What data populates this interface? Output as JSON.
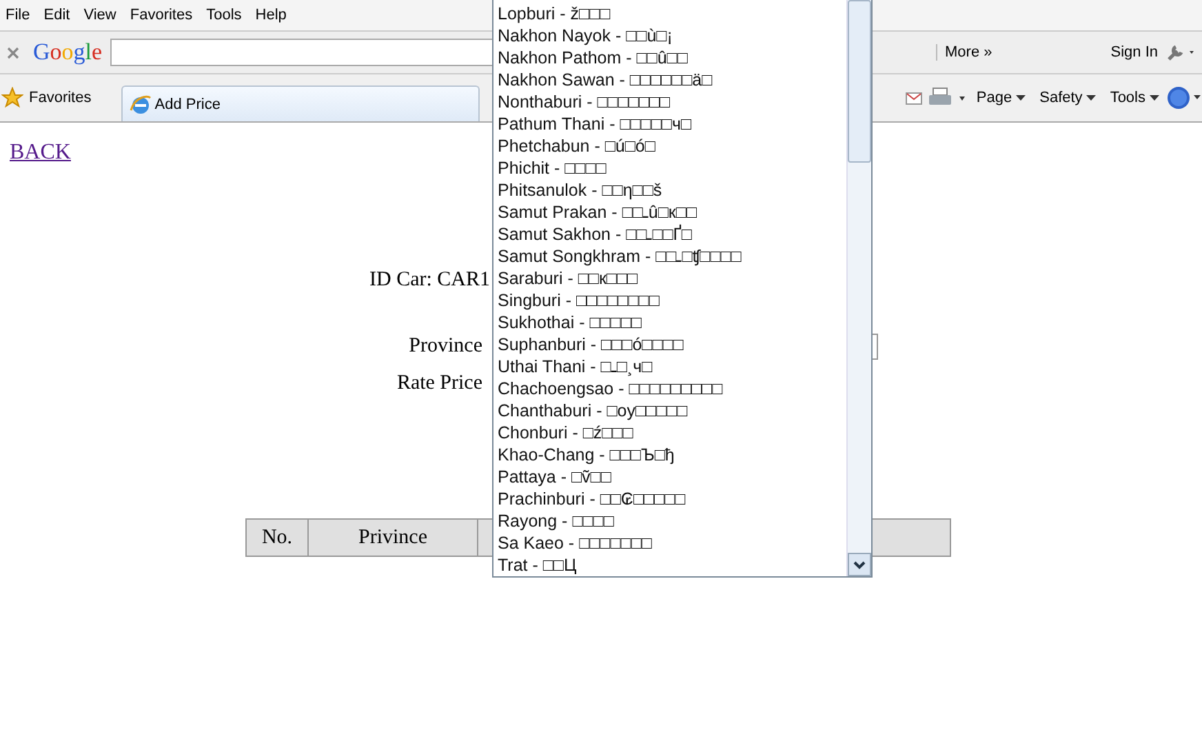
{
  "menu_bar": [
    "File",
    "Edit",
    "View",
    "Favorites",
    "Tools",
    "Help"
  ],
  "google_toolbar": {
    "logo": "Google",
    "more": "More »",
    "sign_in": "Sign In"
  },
  "favorites_bar": {
    "favorites": "Favorites",
    "tab": "Add Price",
    "commands": [
      "Page",
      "Safety",
      "Tools"
    ]
  },
  "page": {
    "back_link": "BACK",
    "id_car": "ID Car: CAR1",
    "fields": [
      {
        "label": "Province",
        "kind": "select"
      },
      {
        "label": "Rate Price",
        "kind": "text"
      }
    ],
    "table": {
      "columns": [
        "No.",
        "Privince"
      ]
    }
  },
  "dropdown": {
    "options": [
      "Lopburi - ž□□□",
      "Nakhon Nayok - □□ù□¡",
      "Nakhon Pathom - □□û□□",
      "Nakhon Sawan - □□□□□□ä□",
      "Nonthaburi - □□□□□□□",
      "Pathum Thani - □□□□□ч□",
      "Phetchabun - □ú□ó□",
      "Phichit - □□□□",
      "Phitsanulok - □□η□□š",
      "Samut Prakan - □□ـû□к□□",
      "Samut Sakhon - □□ـ□□Ґ□",
      "Samut Songkhram - □□ـ□ʧ□□□□",
      "Saraburi - □□к□□□",
      "Singburi - □□□□□□□□",
      "Sukhothai - □□□□□",
      "Suphanburi - □□□ó□□□□",
      "Uthai Thani - □ـ□¸ч□",
      "Chachoengsao - □□□□□□□□□",
      "Chanthaburi - □oy□□□□□",
      "Chonburi - □ź□□□",
      "Khao-Chang - □□□Ъ□ђ",
      "Pattaya - □ṽ□□",
      "Prachinburi - □□₢□□□□□",
      "Rayong - □□□□",
      "Sa Kaeo - □□□□□□□",
      "Trat - □□Ц"
    ]
  }
}
